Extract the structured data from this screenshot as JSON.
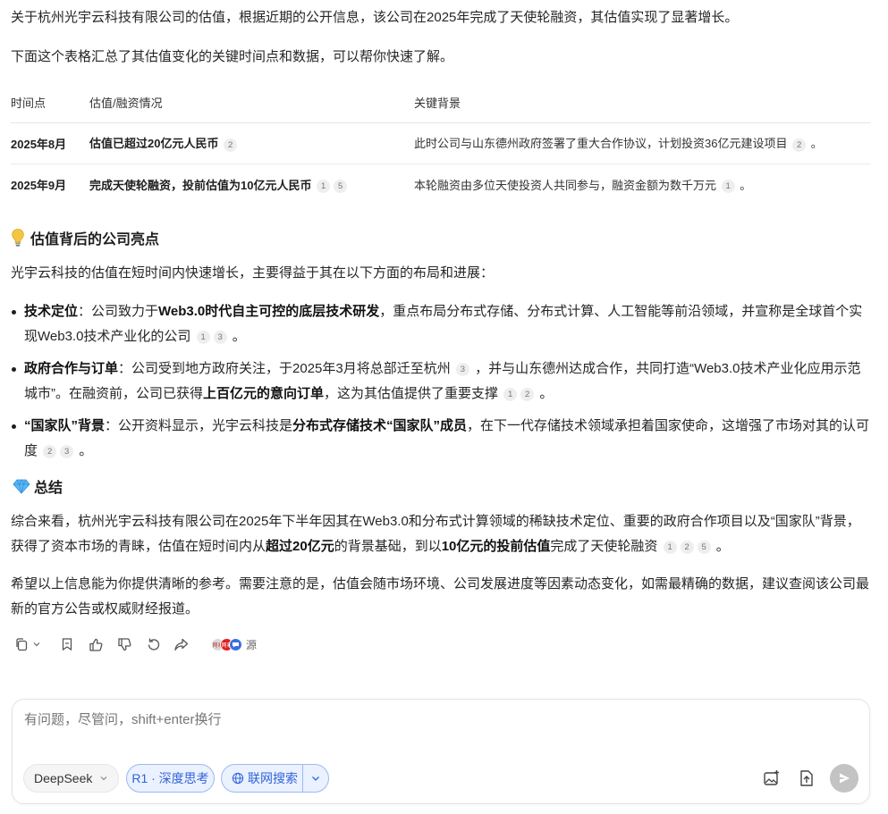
{
  "intro": {
    "p1": "关于杭州光宇云科技有限公司的估值，根据近期的公开信息，该公司在2025年完成了天使轮融资，其估值实现了显著增长。",
    "p2": "下面这个表格汇总了其估值变化的关键时间点和数据，可以帮你快速了解。"
  },
  "table": {
    "headers": [
      "时间点",
      "估值/融资情况",
      "关键背景"
    ],
    "rows": [
      {
        "time": "2025年8月",
        "valuation": "估值已超过20亿元人民币",
        "valuation_cites": [
          "2"
        ],
        "background": "此时公司与山东德州政府签署了重大合作协议，计划投资36亿元建设项目",
        "background_cites": [
          "2"
        ],
        "tail": "。"
      },
      {
        "time": "2025年9月",
        "valuation": "完成天使轮融资，投前估值为10亿元人民币",
        "valuation_cites": [
          "1",
          "5"
        ],
        "background": "本轮融资由多位天使投资人共同参与，融资金额为数千万元",
        "background_cites": [
          "1"
        ],
        "tail": "。"
      }
    ]
  },
  "highlights": {
    "heading": "估值背后的公司亮点",
    "lead": "光宇云科技的估值在短时间内快速增长，主要得益于其在以下方面的布局和进展：",
    "bullets": [
      {
        "title": "技术定位",
        "a": "：公司致力于",
        "b": "Web3.0时代自主可控的底层技术研发",
        "c": "，重点布局分布式存储、分布式计算、人工智能等前沿领域，并宣称是全球首个实现Web3.0技术产业化的公司",
        "cites": [
          "1",
          "3"
        ],
        "end": "。"
      },
      {
        "title": "政府合作与订单",
        "a": "：公司受到地方政府关注，于2025年3月将总部迁至杭州",
        "cites_a": [
          "3"
        ],
        "b2": "，并与山东德州达成合作，共同打造“Web3.0技术产业化应用示范城市”。在融资前，公司已获得",
        "bold": "上百亿元的意向订单",
        "c": "，这为其估值提供了重要支撑",
        "cites": [
          "1",
          "2"
        ],
        "end": "。"
      },
      {
        "title": "“国家队”背景",
        "a": "：公开资料显示，光宇云科技是",
        "bold": "分布式存储技术“国家队”成员",
        "c": "，在下一代存储技术领域承担着国家使命，这增强了市场对其的认可度",
        "cites": [
          "2",
          "3"
        ],
        "end": "。"
      }
    ]
  },
  "summary": {
    "heading": "总结",
    "p1a": "综合来看，杭州光宇云科技有限公司在2025年下半年因其在Web3.0和分布式计算领域的稀缺技术定位、重要的政府合作项目以及“国家队”背景，获得了资本市场的青睐，估值在短时间内从",
    "p1b": "超过20亿元",
    "p1c": "的背景基础，到以",
    "p1d": "10亿元的投前估值",
    "p1e": "完成了天使轮融资",
    "p1_cites": [
      "1",
      "2",
      "5"
    ],
    "p1_end": "。",
    "p2": "希望以上信息能为你提供清晰的参考。需要注意的是，估值会随市场环境、公司发展进度等因素动态变化，如需最精确的数据，建议查阅该公司最新的官方公告或权威财经报道。"
  },
  "actions": {
    "icons": [
      "copy-icon",
      "chevron-down-icon",
      "bookmark-icon",
      "thumbs-up-icon",
      "thumbs-down-icon",
      "regenerate-icon",
      "share-icon"
    ],
    "source_label": "源",
    "source_dots": [
      {
        "color": "#d9d9d9",
        "text": "网易"
      },
      {
        "color": "#e02020",
        "text": "网易"
      },
      {
        "color": "#3b6fe0",
        "text": ""
      }
    ]
  },
  "composer": {
    "placeholder": "有问题，尽管问，shift+enter换行",
    "model_label": "DeepSeek",
    "think_label": "R1 · 深度思考",
    "search_label": "联网搜索"
  },
  "colors": {
    "accent": "#3264d9",
    "pill_bg": "#eaf1ff",
    "send_disabled": "#c3c3c3"
  }
}
